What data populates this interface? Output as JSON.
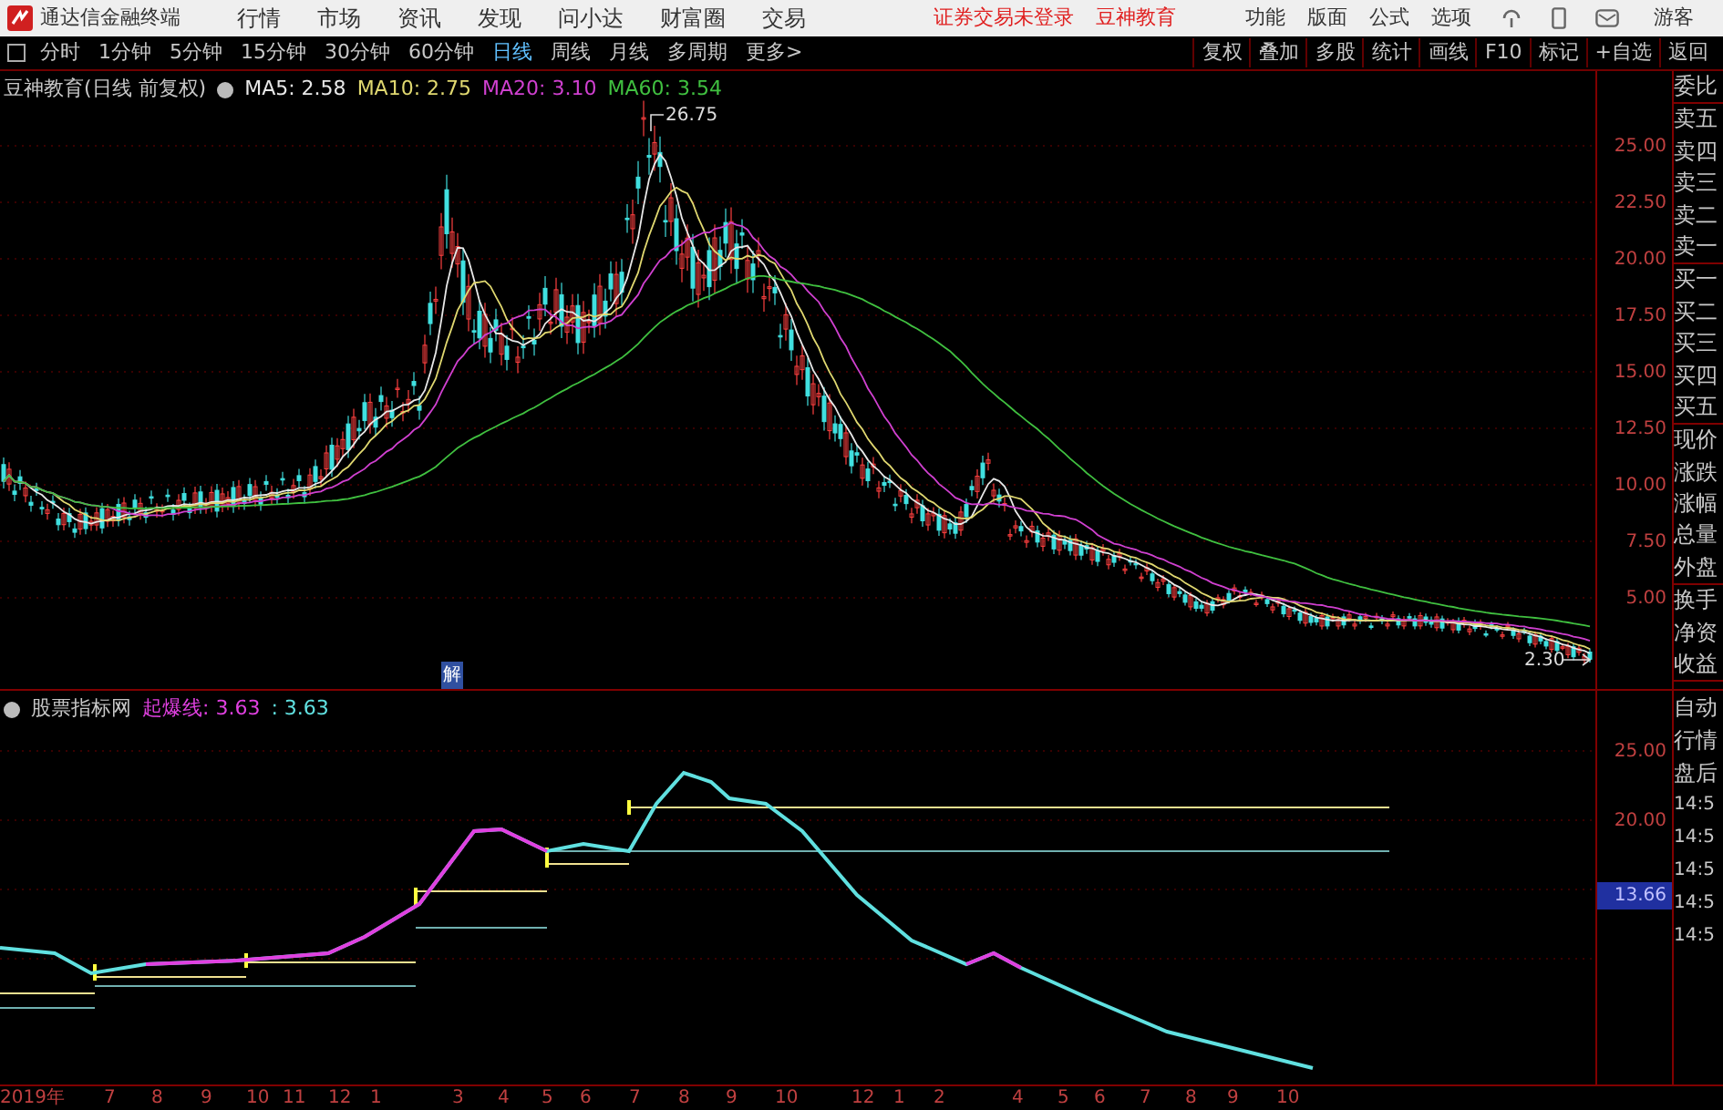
{
  "app": {
    "title": "通达信金融终端",
    "menu": [
      "行情",
      "市场",
      "资讯",
      "发现",
      "问小达",
      "财富圈",
      "交易"
    ],
    "notices": [
      "证券交易未登录",
      "豆神教育"
    ],
    "tools": [
      "功能",
      "版面",
      "公式",
      "选项"
    ],
    "user": "游客"
  },
  "toolbar": {
    "periods": [
      {
        "label": "分时",
        "selected": false
      },
      {
        "label": "1分钟",
        "selected": false
      },
      {
        "label": "5分钟",
        "selected": false
      },
      {
        "label": "15分钟",
        "selected": false
      },
      {
        "label": "30分钟",
        "selected": false
      },
      {
        "label": "60分钟",
        "selected": false
      },
      {
        "label": "日线",
        "selected": true
      },
      {
        "label": "周线",
        "selected": false
      },
      {
        "label": "月线",
        "selected": false
      },
      {
        "label": "多周期",
        "selected": false
      }
    ],
    "more": "更多>",
    "actions": [
      "复权",
      "叠加",
      "多股",
      "统计",
      "画线",
      "F10",
      "标记",
      "+自选",
      "返回"
    ]
  },
  "main_chart": {
    "title": "豆神教育(日线 前复权)",
    "indicators": [
      {
        "label": "MA5: 2.58",
        "color": "#e8e8e8"
      },
      {
        "label": "MA10: 2.75",
        "color": "#e0d870"
      },
      {
        "label": "MA20: 3.10",
        "color": "#d040d0"
      },
      {
        "label": "MA60: 3.54",
        "color": "#40c040"
      }
    ],
    "high_label": "26.75",
    "low_label": "2.30",
    "event_marker": "解",
    "y_ticks": [
      "25.00",
      "22.50",
      "20.00",
      "17.50",
      "15.00",
      "12.50",
      "10.00",
      "7.50",
      "5.00"
    ]
  },
  "quote_groups": [
    [
      "委比"
    ],
    [
      "卖五",
      "卖四",
      "卖三",
      "卖二",
      "卖一"
    ],
    [
      "买一",
      "买二",
      "买三",
      "买四",
      "买五"
    ],
    [
      "现价",
      "涨跌",
      "涨幅",
      "总量",
      "外盘"
    ],
    [
      "换手",
      "净资",
      "收益"
    ]
  ],
  "indicator_panel": {
    "name": "股票指标网",
    "line_label": "起爆线: 3.63",
    "second_value": ": 3.63",
    "y_ticks": [
      "25.00",
      "20.00"
    ],
    "current_value": "13.66"
  },
  "status_labels": [
    "自动",
    "行情",
    "盘后"
  ],
  "times": [
    "14:5",
    "14:5",
    "14:5",
    "14:5",
    "14:5"
  ],
  "x_axis": [
    "2019年",
    "7",
    "8",
    "9",
    "10",
    "11",
    "12",
    "1",
    "3",
    "4",
    "5",
    "6",
    "7",
    "8",
    "9",
    "10",
    "12",
    "1",
    "2",
    "4",
    "5",
    "6",
    "7",
    "8",
    "9",
    "10"
  ]
}
